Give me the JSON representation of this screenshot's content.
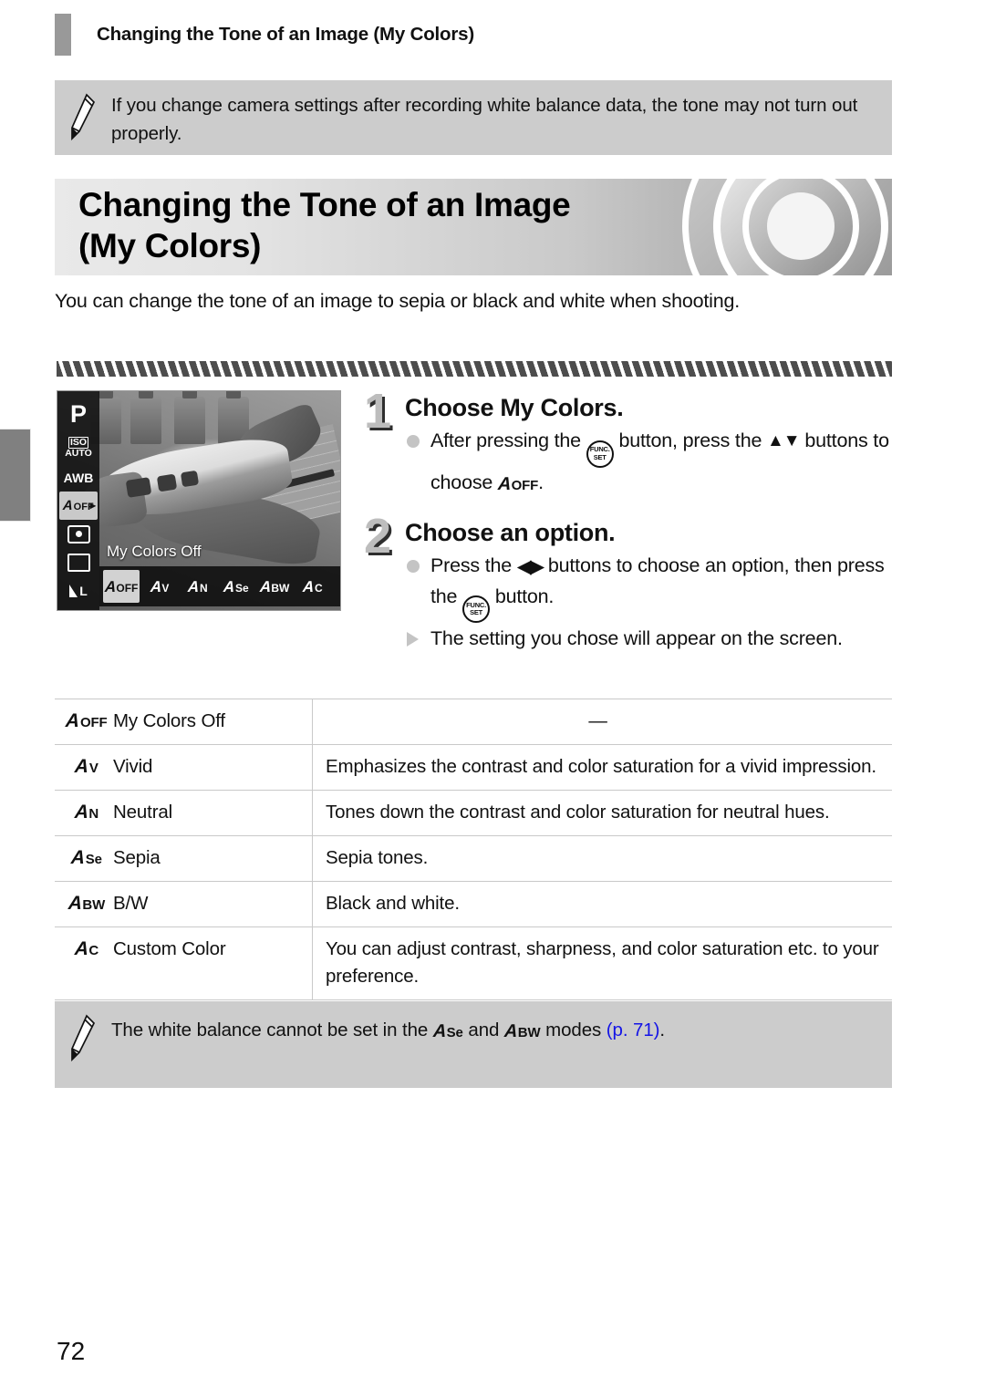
{
  "running_header": {
    "title": "Changing the Tone of an Image (My Colors)"
  },
  "note_top": {
    "icon": "pencil-icon",
    "text": "If you change camera settings after recording white balance data, the tone may not turn out properly."
  },
  "banner": {
    "title_line1": "Changing the Tone of an Image",
    "title_line2": "(My Colors)"
  },
  "intro": {
    "text": "You can change the tone of an image to sepia or black and white when shooting."
  },
  "lcd": {
    "caption": "My Colors Off",
    "sidebar": [
      {
        "name": "shooting-mode",
        "label": "P"
      },
      {
        "name": "iso-speed",
        "label_top": "ISO",
        "label_bottom": "AUTO"
      },
      {
        "name": "white-balance",
        "label": "AWB"
      },
      {
        "name": "my-colors",
        "glyph_a": "A",
        "glyph_sub": "OFF",
        "selected": true
      },
      {
        "name": "metering-mode",
        "label": ""
      },
      {
        "name": "drive-mode",
        "label": ""
      },
      {
        "name": "image-quality",
        "label": "L"
      }
    ],
    "options": [
      {
        "a": "A",
        "sub": "OFF",
        "selected": true
      },
      {
        "a": "A",
        "sub": "V",
        "selected": false
      },
      {
        "a": "A",
        "sub": "N",
        "selected": false
      },
      {
        "a": "A",
        "sub": "Se",
        "selected": false
      },
      {
        "a": "A",
        "sub": "BW",
        "selected": false
      },
      {
        "a": "A",
        "sub": "C",
        "selected": false
      }
    ]
  },
  "steps": [
    {
      "number": "1",
      "heading": "Choose My Colors.",
      "bullets": [
        {
          "marker": "dot",
          "parts": [
            {
              "type": "text",
              "value": "After pressing the "
            },
            {
              "type": "icon",
              "value": "func-set-button"
            },
            {
              "type": "text",
              "value": " button, press the "
            },
            {
              "type": "icon",
              "value": "up-down-buttons"
            },
            {
              "type": "text",
              "value": " buttons to choose "
            },
            {
              "type": "icon",
              "value": "my-colors-off-icon"
            },
            {
              "type": "text",
              "value": "."
            }
          ]
        }
      ]
    },
    {
      "number": "2",
      "heading": "Choose an option.",
      "bullets": [
        {
          "marker": "dot",
          "parts": [
            {
              "type": "text",
              "value": "Press the "
            },
            {
              "type": "icon",
              "value": "left-right-buttons"
            },
            {
              "type": "text",
              "value": " buttons to choose an option, then press the "
            },
            {
              "type": "icon",
              "value": "func-set-button"
            },
            {
              "type": "text",
              "value": " button."
            }
          ]
        },
        {
          "marker": "triangle",
          "parts": [
            {
              "type": "text",
              "value": "The setting you chose will appear on the screen."
            }
          ]
        }
      ]
    }
  ],
  "func_set_label": {
    "top": "FUNC.",
    "bottom": "SET"
  },
  "arrows": {
    "up_down": "▲▼",
    "left_right": "◀▶"
  },
  "table": {
    "rows": [
      {
        "icon_a": "A",
        "icon_sub": "OFF",
        "name": "My Colors Off",
        "desc": "—",
        "desc_is_dash": true
      },
      {
        "icon_a": "A",
        "icon_sub": "V",
        "name": "Vivid",
        "desc": "Emphasizes the contrast and color saturation for a vivid impression.",
        "desc_is_dash": false
      },
      {
        "icon_a": "A",
        "icon_sub": "N",
        "name": "Neutral",
        "desc": "Tones down the contrast and color saturation for neutral hues.",
        "desc_is_dash": false
      },
      {
        "icon_a": "A",
        "icon_sub": "Se",
        "name": "Sepia",
        "desc": "Sepia tones.",
        "desc_is_dash": false
      },
      {
        "icon_a": "A",
        "icon_sub": "BW",
        "name": "B/W",
        "desc": "Black and white.",
        "desc_is_dash": false
      },
      {
        "icon_a": "A",
        "icon_sub": "C",
        "name": "Custom Color",
        "desc": "You can adjust contrast, sharpness, and color saturation etc. to your preference.",
        "desc_is_dash": false
      }
    ]
  },
  "note_bottom": {
    "icon": "pencil-icon",
    "text_before": "The white balance cannot be set in the ",
    "icon1_a": "A",
    "icon1_sub": "Se",
    "text_middle": " and ",
    "icon2_a": "A",
    "icon2_sub": "BW",
    "text_after": " modes ",
    "page_ref": "(p. 71)",
    "text_end": "."
  },
  "page_number": "72",
  "colors": {
    "note_bg": "#cccccc",
    "tab_grey": "#808080",
    "link_blue": "#1414e6",
    "step_num_grey": "#bdbdbd"
  }
}
